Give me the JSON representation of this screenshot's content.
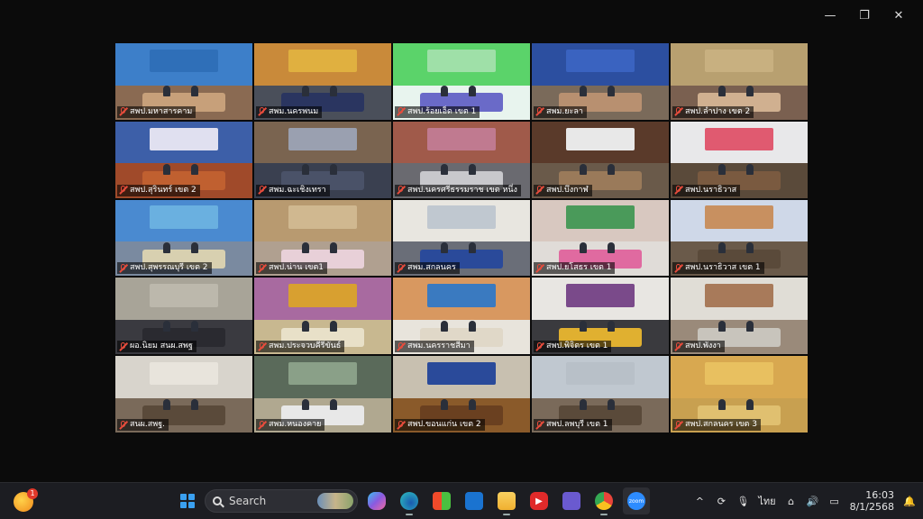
{
  "window_controls": {
    "minimize": "—",
    "maximize": "❐",
    "close": "✕"
  },
  "tiles": [
    {
      "label": "สพป.มหาสารคาม",
      "wall": "#3d7fc9",
      "floor": "#8a6a52",
      "table": "#c7a07a",
      "banner": "#2f6fb8"
    },
    {
      "label": "สพม.นครพนม",
      "wall": "#c98a3a",
      "floor": "#4a4f5a",
      "table": "#2a3560",
      "banner": "#e0b040"
    },
    {
      "label": "สพป.ร้อยเอ็ด เขต 1",
      "wall": "#5bd36a",
      "floor": "#e8f4ee",
      "table": "#6a6ac8",
      "banner": "#9fe0a8",
      "active": false
    },
    {
      "label": "สพม.ยะลา",
      "wall": "#2c4fa0",
      "floor": "#7a6a5a",
      "table": "#b89070",
      "banner": "#3a63c0"
    },
    {
      "label": "สพป.ลำปาง เขต 2",
      "wall": "#b8a070",
      "floor": "#7a6050",
      "table": "#d0b090",
      "banner": "#c8b080"
    },
    {
      "label": "สพป.สุรินทร์ เขต 2",
      "wall": "#3d5fa8",
      "floor": "#a04a2a",
      "table": "#c06030",
      "banner": "#e0e0f0"
    },
    {
      "label": "สพม.ฉะเชิงเทรา",
      "wall": "#7a6450",
      "floor": "#3a4050",
      "table": "#4a5268",
      "banner": "#9aa0b0"
    },
    {
      "label": "สพป.นครศรีธรรมราช เขต หนึ่ง",
      "wall": "#a05a4a",
      "floor": "#6a6a70",
      "table": "#c8c8cc",
      "banner": "#c07a90"
    },
    {
      "label": "สพป.บึงกาฬ",
      "wall": "#5a3a2a",
      "floor": "#6a5a4a",
      "table": "#9a7a5a",
      "banner": "#e8e8e8"
    },
    {
      "label": "สพป.นราธิวาส",
      "wall": "#e8e8ea",
      "floor": "#5a4a3a",
      "table": "#7a5a40",
      "banner": "#e05a70"
    },
    {
      "label": "สพป.สุพรรณบุรี เขต 2",
      "wall": "#4a8ad0",
      "floor": "#7a8aa0",
      "table": "#d8d0b0",
      "banner": "#6ab0e0"
    },
    {
      "label": "สพป.น่าน เขต1",
      "wall": "#b89a70",
      "floor": "#b0a090",
      "table": "#e8d0d8",
      "banner": "#d0b890"
    },
    {
      "label": "สพม.สกลนคร",
      "wall": "#e8e6e0",
      "floor": "#6a6e78",
      "table": "#2a4a9a",
      "banner": "#c0c8d0"
    },
    {
      "label": "สพป.ยโสธร เขต 1",
      "wall": "#d8c8c0",
      "floor": "#e0dcd8",
      "table": "#e06aa0",
      "banner": "#4a9a5a"
    },
    {
      "label": "สพป.นราธิวาส เขต 1",
      "wall": "#cfd8e8",
      "floor": "#6a5a4a",
      "table": "#5a4a3a",
      "banner": "#c89060"
    },
    {
      "label": "ผอ.นิยม สนผ.สพฐ",
      "wall": "#a8a498",
      "floor": "#3a3a40",
      "table": "#2a2a30",
      "banner": "#bcb8ac"
    },
    {
      "label": "สพม.ประจวบคีรีขันธ์",
      "wall": "#a86aa0",
      "floor": "#c8b890",
      "table": "#e8e0c8",
      "banner": "#d8a030"
    },
    {
      "label": "สพม.นครราชสีมา",
      "wall": "#d89860",
      "floor": "#e8e4dc",
      "table": "#e0d8c8",
      "banner": "#3a7ac0"
    },
    {
      "label": "สพป.พิจิตร เขต 1",
      "wall": "#e8e6e2",
      "floor": "#3a3a3e",
      "table": "#e0b030",
      "banner": "#7a4a8a"
    },
    {
      "label": "สพป.พังงา",
      "wall": "#e0ddd6",
      "floor": "#9a8a7a",
      "table": "#c8c4bc",
      "banner": "#a87a5a"
    },
    {
      "label": "สนผ.สพฐ.",
      "wall": "#d8d4cc",
      "floor": "#7a6a5a",
      "table": "#5a4a3a",
      "banner": "#e8e4dc"
    },
    {
      "label": "สพม.หนองคาย",
      "wall": "#5a6a5a",
      "floor": "#b0a890",
      "table": "#e8e8e8",
      "banner": "#8aa088"
    },
    {
      "label": "สพป.ขอนแก่น เขต 2",
      "wall": "#c8c0b0",
      "floor": "#8a5a2a",
      "table": "#6a4020",
      "banner": "#2a4a9a",
      "active": true
    },
    {
      "label": "สพป.ลพบุรี เขต 1",
      "wall": "#c0c8d0",
      "floor": "#7a6a5a",
      "table": "#5a4a3a",
      "banner": "#b8c0c8"
    },
    {
      "label": "สพป.สกลนคร เขต 3",
      "wall": "#d8a850",
      "floor": "#c8a050",
      "table": "#e0c070",
      "banner": "#e8c060"
    }
  ],
  "taskbar": {
    "weather_badge": "1",
    "search_placeholder": "Search",
    "apps": [
      "start-icon",
      "search",
      "copilot-icon",
      "edge-icon",
      "store-icon",
      "outlook-icon",
      "file-explorer-icon",
      "youtube-icon",
      "teams-icon",
      "chrome-icon",
      "zoom-icon"
    ],
    "app_colors": {
      "copilot": "#8a5ae0",
      "edge": "#1fa0c8",
      "store": "#3a7ad8",
      "outlook": "#1a73d0",
      "explorer": "#f0b830",
      "youtube": "#e02a2a",
      "teams": "#6a5ad0",
      "chrome": "#e8b020",
      "zoom": "#2d8cff"
    },
    "zoom_label": "zoom",
    "tray": {
      "chevron": "^",
      "language": "ไทย",
      "time": "16:03",
      "date": "8/1/2568"
    }
  }
}
